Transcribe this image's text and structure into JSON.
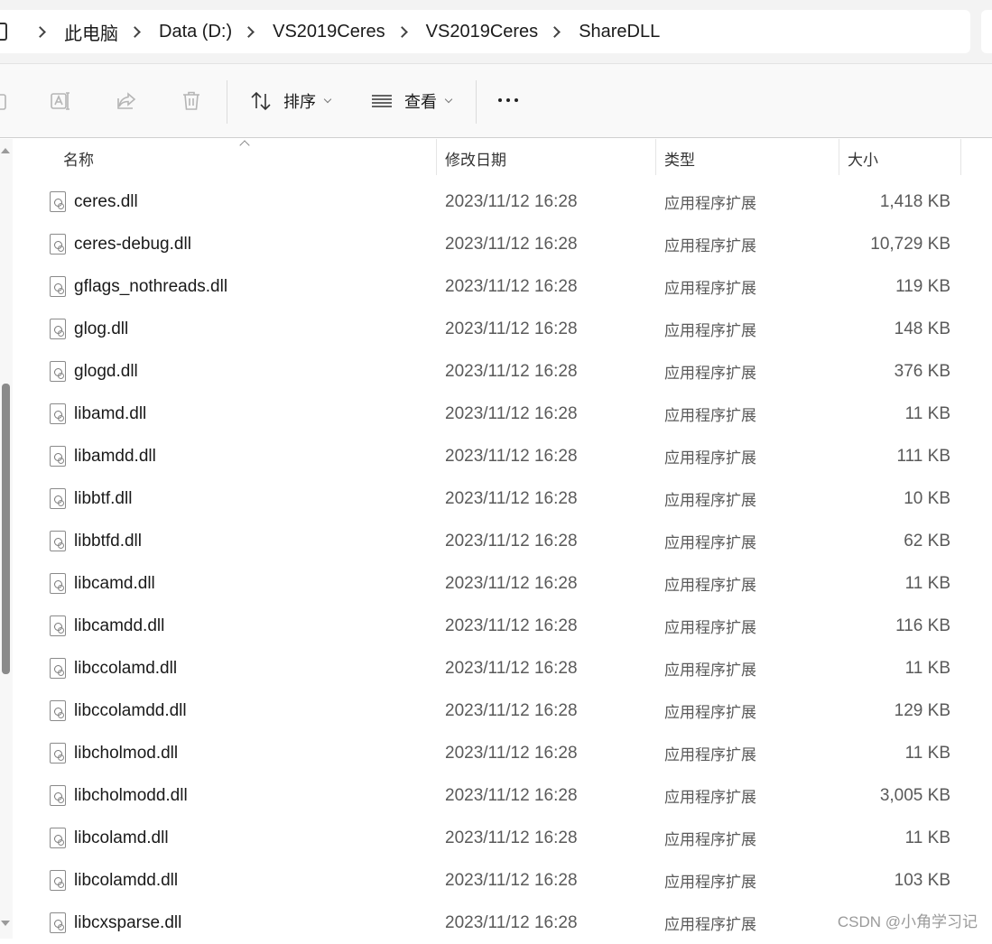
{
  "breadcrumb": [
    "此电脑",
    "Data (D:)",
    "VS2019Ceres",
    "VS2019Ceres",
    "ShareDLL"
  ],
  "toolbar": {
    "sort_label": "排序",
    "view_label": "查看"
  },
  "columns": {
    "name": "名称",
    "date": "修改日期",
    "type": "类型",
    "size": "大小"
  },
  "files": [
    {
      "name": "ceres.dll",
      "date": "2023/11/12 16:28",
      "type": "应用程序扩展",
      "size": "1,418 KB"
    },
    {
      "name": "ceres-debug.dll",
      "date": "2023/11/12 16:28",
      "type": "应用程序扩展",
      "size": "10,729 KB"
    },
    {
      "name": "gflags_nothreads.dll",
      "date": "2023/11/12 16:28",
      "type": "应用程序扩展",
      "size": "119 KB"
    },
    {
      "name": "glog.dll",
      "date": "2023/11/12 16:28",
      "type": "应用程序扩展",
      "size": "148 KB"
    },
    {
      "name": "glogd.dll",
      "date": "2023/11/12 16:28",
      "type": "应用程序扩展",
      "size": "376 KB"
    },
    {
      "name": "libamd.dll",
      "date": "2023/11/12 16:28",
      "type": "应用程序扩展",
      "size": "11 KB"
    },
    {
      "name": "libamdd.dll",
      "date": "2023/11/12 16:28",
      "type": "应用程序扩展",
      "size": "111 KB"
    },
    {
      "name": "libbtf.dll",
      "date": "2023/11/12 16:28",
      "type": "应用程序扩展",
      "size": "10 KB"
    },
    {
      "name": "libbtfd.dll",
      "date": "2023/11/12 16:28",
      "type": "应用程序扩展",
      "size": "62 KB"
    },
    {
      "name": "libcamd.dll",
      "date": "2023/11/12 16:28",
      "type": "应用程序扩展",
      "size": "11 KB"
    },
    {
      "name": "libcamdd.dll",
      "date": "2023/11/12 16:28",
      "type": "应用程序扩展",
      "size": "116 KB"
    },
    {
      "name": "libccolamd.dll",
      "date": "2023/11/12 16:28",
      "type": "应用程序扩展",
      "size": "11 KB"
    },
    {
      "name": "libccolamdd.dll",
      "date": "2023/11/12 16:28",
      "type": "应用程序扩展",
      "size": "129 KB"
    },
    {
      "name": "libcholmod.dll",
      "date": "2023/11/12 16:28",
      "type": "应用程序扩展",
      "size": "11 KB"
    },
    {
      "name": "libcholmodd.dll",
      "date": "2023/11/12 16:28",
      "type": "应用程序扩展",
      "size": "3,005 KB"
    },
    {
      "name": "libcolamd.dll",
      "date": "2023/11/12 16:28",
      "type": "应用程序扩展",
      "size": "11 KB"
    },
    {
      "name": "libcolamdd.dll",
      "date": "2023/11/12 16:28",
      "type": "应用程序扩展",
      "size": "103 KB"
    },
    {
      "name": "libcxsparse.dll",
      "date": "2023/11/12 16:28",
      "type": "应用程序扩展",
      "size": ""
    }
  ],
  "watermark": "CSDN @小角学习记"
}
